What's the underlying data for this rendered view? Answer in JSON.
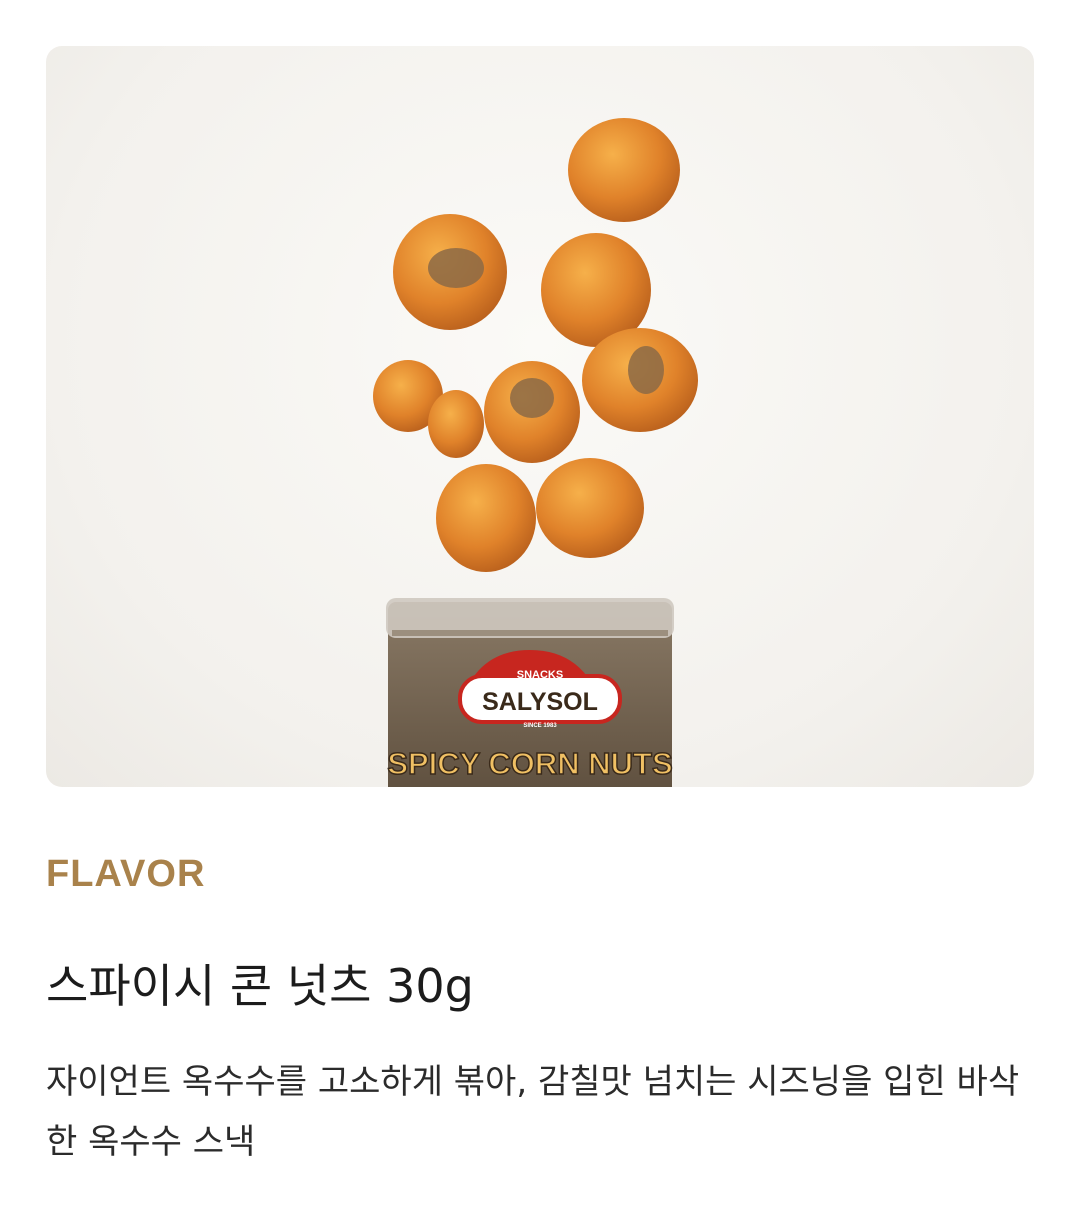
{
  "product": {
    "category_label": "FLAVOR",
    "title": "스파이시 콘 넛츠 30g",
    "description": "자이언트 옥수수를 고소하게 볶아, 감칠맛 넘치는 시즈닝을 입힌 바삭한 옥수수 스낵"
  },
  "packaging": {
    "badge_top": "SNACKS",
    "brand": "SALYSOL",
    "since": "SINCE 1983",
    "product_name": "SPICY CORN NUTS"
  },
  "colors": {
    "accent": "#a9824b",
    "corn": "#e08a2a",
    "can": "#7a6a55"
  }
}
